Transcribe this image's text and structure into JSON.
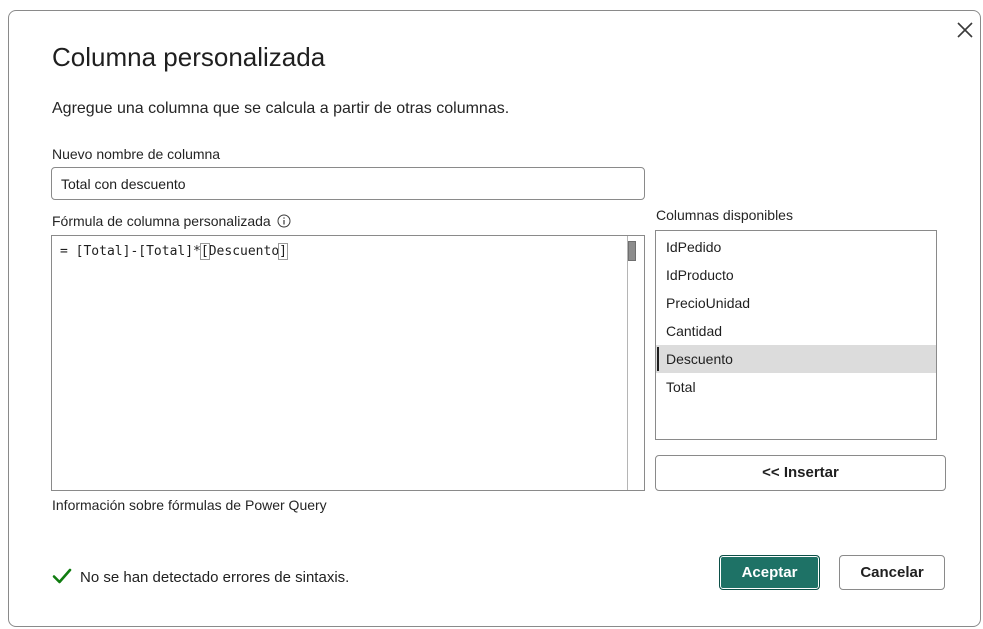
{
  "dialog": {
    "title": "Columna personalizada",
    "subtitle": "Agregue una columna que se calcula a partir de otras columnas.",
    "close_icon": "close-icon"
  },
  "name_field": {
    "label": "Nuevo nombre de columna",
    "value": "Total con descuento"
  },
  "formula": {
    "label": "Fórmula de columna personalizada",
    "info_icon": "info-icon",
    "text_prefix": "= [Total]-[Total]*",
    "open_bracket": "[",
    "text_inner": "Descuento",
    "close_bracket": "]"
  },
  "columns": {
    "label": "Columnas disponibles",
    "items": [
      "IdPedido",
      "IdProducto",
      "PrecioUnidad",
      "Cantidad",
      "Descuento",
      "Total"
    ],
    "selected": "Descuento"
  },
  "buttons": {
    "insert": "<< Insertar",
    "accept": "Aceptar",
    "cancel": "Cancelar"
  },
  "help_link": "Información sobre fórmulas de Power Query",
  "status": {
    "icon": "checkmark-icon",
    "text": "No se han detectado errores de sintaxis.",
    "color": "#107c10"
  },
  "colors": {
    "accent": "#1e7266",
    "selection": "#dcdcdc"
  }
}
